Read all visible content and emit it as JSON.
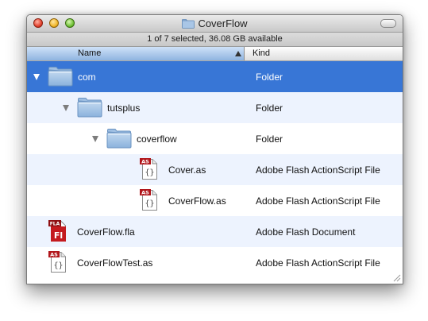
{
  "window": {
    "title": "CoverFlow",
    "status": "1 of 7 selected, 36.08 GB available"
  },
  "columns": {
    "name": "Name",
    "kind": "Kind",
    "sort": "ascending"
  },
  "colors": {
    "selection": "#3876d6",
    "alternate_row": "#edf3fe",
    "folder": "#8bb2dc"
  },
  "rows": [
    {
      "name": "com",
      "kind": "Folder",
      "icon": "folder-icon",
      "level": 0,
      "expanded": true,
      "selected": true
    },
    {
      "name": "tutsplus",
      "kind": "Folder",
      "icon": "folder-icon",
      "level": 1,
      "expanded": true,
      "selected": false
    },
    {
      "name": "coverflow",
      "kind": "Folder",
      "icon": "folder-icon",
      "level": 2,
      "expanded": true,
      "selected": false
    },
    {
      "name": "Cover.as",
      "kind": "Adobe Flash ActionScript File",
      "icon": "actionscript-file-icon",
      "badge": "AS",
      "level": 3,
      "selected": false
    },
    {
      "name": "CoverFlow.as",
      "kind": "Adobe Flash ActionScript File",
      "icon": "actionscript-file-icon",
      "badge": "AS",
      "level": 3,
      "selected": false
    },
    {
      "name": "CoverFlow.fla",
      "kind": "Adobe Flash Document",
      "icon": "flash-document-icon",
      "badge": "FLA",
      "glyph": "Fl",
      "level": 0,
      "selected": false
    },
    {
      "name": "CoverFlowTest.as",
      "kind": "Adobe Flash ActionScript File",
      "icon": "actionscript-file-icon",
      "badge": "AS",
      "level": 0,
      "selected": false
    }
  ]
}
